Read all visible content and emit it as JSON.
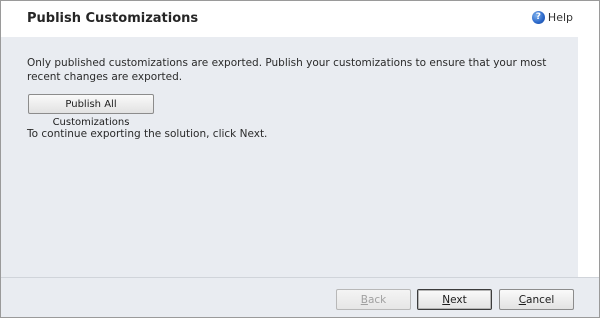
{
  "header": {
    "title": "Publish Customizations",
    "help_label": "Help",
    "help_icon": "help-icon"
  },
  "main": {
    "description": "Only published customizations are exported. Publish your customizations to ensure that your most recent changes are exported.",
    "publish_button_label": "Publish All Customizations",
    "continue_text": "To continue exporting the solution, click Next."
  },
  "footer": {
    "back": {
      "accel": "B",
      "rest": "ack",
      "enabled": false
    },
    "next": {
      "accel": "N",
      "rest": "ext",
      "enabled": true
    },
    "cancel": {
      "accel": "C",
      "rest": "ancel",
      "enabled": true
    }
  },
  "colors": {
    "content_background": "#e9ecf1",
    "disabled_text": "#a0a0a0"
  }
}
